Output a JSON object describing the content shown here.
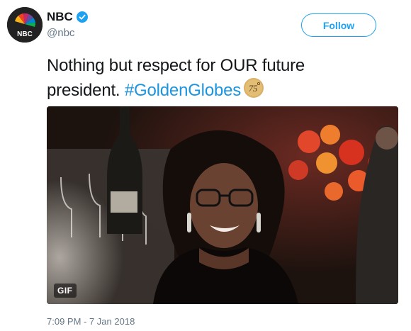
{
  "account": {
    "display_name": "NBC",
    "handle": "@nbc",
    "avatar_label": "NBC",
    "verified": true
  },
  "follow_label": "Follow",
  "tweet": {
    "text": "Nothing but respect for OUR future president.",
    "hashtag": "#GoldenGlobes",
    "badge_icon": "golden-globes-75-icon",
    "badge_text": "75"
  },
  "media": {
    "type": "gif",
    "badge": "GIF"
  },
  "timestamp": "7:09 PM - 7 Jan 2018",
  "colors": {
    "link": "#1b95e0",
    "follow": "#1da1f2",
    "muted": "#657786"
  }
}
